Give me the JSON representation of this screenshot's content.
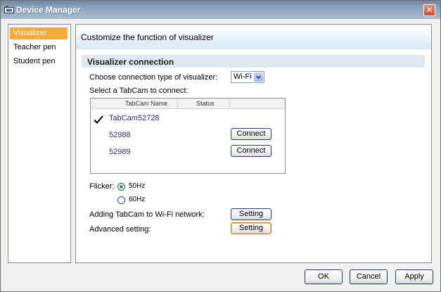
{
  "window": {
    "title": "Device Manager",
    "close_symbol": "✕"
  },
  "sidebar": {
    "items": [
      {
        "label": "Visualizer",
        "active": true
      },
      {
        "label": "Teacher pen",
        "active": false
      },
      {
        "label": "Student pen",
        "active": false
      }
    ]
  },
  "main": {
    "header_title": "Customize the function of visualizer",
    "section_title": "Visualizer connection",
    "connection_type_label": "Choose connection type of visualizer:",
    "connection_type_value": "Wi-Fi",
    "select_tabcam_label": "Select a TabCam to connect:",
    "table": {
      "columns": [
        "TabCam Name",
        "Status"
      ],
      "rows": [
        {
          "name": "TabCam52728",
          "connected": true
        },
        {
          "name": "52988",
          "button": "Connect"
        },
        {
          "name": "52989",
          "button": "Connect"
        }
      ]
    },
    "flicker": {
      "label": "Flicker:",
      "options": [
        "50Hz",
        "60Hz"
      ],
      "selected": "50Hz"
    },
    "add_to_wifi": {
      "label": "Adding TabCam to Wi-Fi network:",
      "button": "Setting"
    },
    "advanced": {
      "label": "Advanced setting:",
      "button": "Setting"
    }
  },
  "footer": {
    "ok": "OK",
    "cancel": "Cancel",
    "apply": "Apply"
  }
}
